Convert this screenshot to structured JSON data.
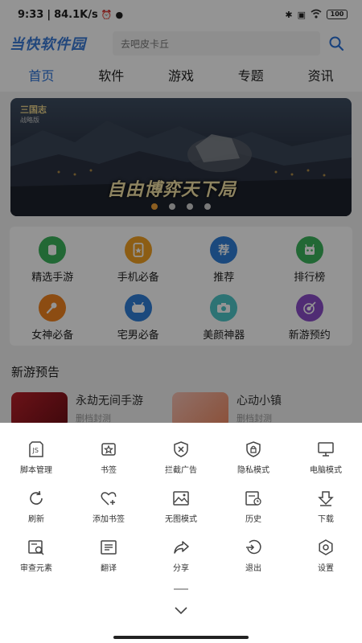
{
  "status": {
    "time": "9:33",
    "speed": "84.1K/s",
    "battery": "100"
  },
  "header": {
    "logo": "当快软件园",
    "search_placeholder": "去吧皮卡丘"
  },
  "tabs": [
    "首页",
    "软件",
    "游戏",
    "专题",
    "资讯"
  ],
  "banner": {
    "logo": "三国志",
    "logo_sub": "战略版",
    "slogan": "自由博弈天下局"
  },
  "grid": [
    {
      "label": "精选手游",
      "icon": "database-icon",
      "color": "#3cb35c"
    },
    {
      "label": "手机必备",
      "icon": "phone-icon",
      "color": "#f2a124"
    },
    {
      "label": "推荐",
      "icon": "recommend-icon",
      "color": "#2f7fd8"
    },
    {
      "label": "排行榜",
      "icon": "robot-icon",
      "color": "#3cb35c"
    },
    {
      "label": "女神必备",
      "icon": "microphone-icon",
      "color": "#f2841f"
    },
    {
      "label": "宅男必备",
      "icon": "gamepad-icon",
      "color": "#2f7fd8"
    },
    {
      "label": "美颜神器",
      "icon": "camera-icon",
      "color": "#4fc7c8"
    },
    {
      "label": "新游预约",
      "icon": "target-icon",
      "color": "#8b4cc9"
    }
  ],
  "new_games": {
    "title": "新游预告",
    "items": [
      {
        "name": "永劫无间手游",
        "status": "删档封测"
      },
      {
        "name": "心动小镇",
        "status": "删档封测"
      }
    ]
  },
  "sheet": {
    "items": [
      {
        "label": "脚本管理",
        "icon": "script-icon"
      },
      {
        "label": "书签",
        "icon": "bookmark-icon"
      },
      {
        "label": "拦截广告",
        "icon": "block-ad-icon"
      },
      {
        "label": "隐私模式",
        "icon": "lock-icon"
      },
      {
        "label": "电脑模式",
        "icon": "monitor-icon"
      },
      {
        "label": "刷新",
        "icon": "refresh-icon"
      },
      {
        "label": "添加书签",
        "icon": "heart-plus-icon"
      },
      {
        "label": "无图模式",
        "icon": "image-icon"
      },
      {
        "label": "历史",
        "icon": "history-icon"
      },
      {
        "label": "下载",
        "icon": "download-icon"
      },
      {
        "label": "审查元素",
        "icon": "inspect-icon"
      },
      {
        "label": "翻译",
        "icon": "translate-icon"
      },
      {
        "label": "分享",
        "icon": "share-icon"
      },
      {
        "label": "退出",
        "icon": "exit-icon"
      },
      {
        "label": "设置",
        "icon": "settings-icon"
      }
    ]
  },
  "colors": {
    "accent": "#2a72d8",
    "dot_active": "#f2a23a"
  }
}
